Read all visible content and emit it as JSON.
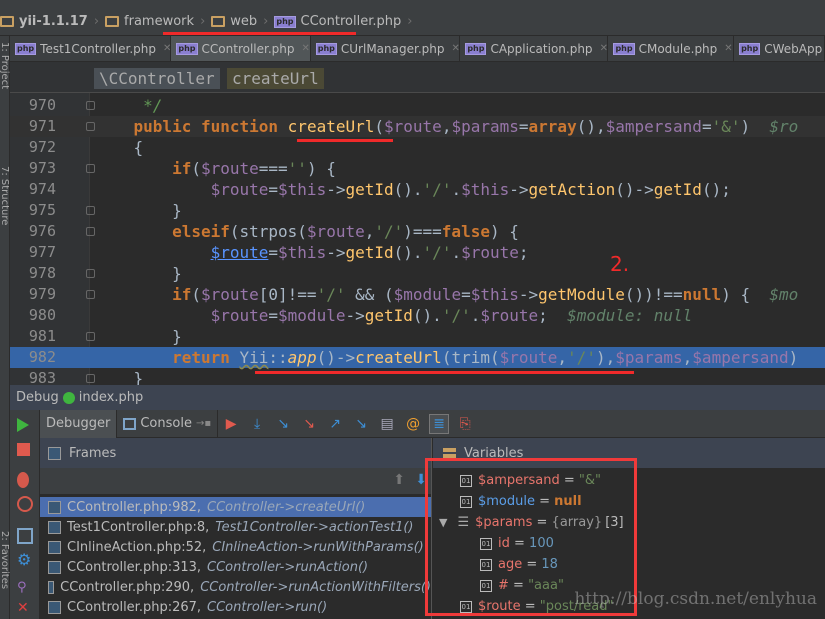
{
  "breadcrumb": [
    "yii-1.1.17",
    "framework",
    "web",
    "CController.php"
  ],
  "tabs": [
    {
      "label": "Test1Controller.php",
      "active": false
    },
    {
      "label": "CController.php",
      "active": true
    },
    {
      "label": "CUrlManager.php",
      "active": false
    },
    {
      "label": "CApplication.php",
      "active": false
    },
    {
      "label": "CModule.php",
      "active": false
    },
    {
      "label": "CWebApp",
      "active": false
    }
  ],
  "side_labels": {
    "project": "1: Project",
    "structure": "7: Structure",
    "favorites": "2: Favorites"
  },
  "navbar": {
    "class": "\\CController",
    "method": "createUrl"
  },
  "editor": {
    "lines": [
      {
        "n": "970",
        "tokens": [
          [
            "t-com",
            "     */"
          ]
        ]
      },
      {
        "n": "971",
        "state": "cur",
        "tokens": [
          [
            "",
            "    "
          ],
          [
            "t-kw",
            "public"
          ],
          [
            "",
            " "
          ],
          [
            "t-kw",
            "function"
          ],
          [
            "",
            " "
          ],
          [
            "t-fn",
            "createUrl"
          ],
          [
            "",
            "("
          ],
          [
            "t-var",
            "$route"
          ],
          [
            "",
            ","
          ],
          [
            "t-var",
            "$params"
          ],
          [
            "",
            "="
          ],
          [
            "t-kw",
            "array"
          ],
          [
            "",
            "(),"
          ],
          [
            "t-var",
            "$ampersand"
          ],
          [
            "",
            "="
          ],
          [
            "t-str",
            "'&'"
          ],
          [
            "",
            ")  "
          ],
          [
            "t-dbg",
            "$ro"
          ]
        ]
      },
      {
        "n": "972",
        "tokens": [
          [
            "",
            "    {"
          ]
        ]
      },
      {
        "n": "973",
        "tokens": [
          [
            "",
            "        "
          ],
          [
            "t-kw",
            "if"
          ],
          [
            "",
            "("
          ],
          [
            "t-var",
            "$route"
          ],
          [
            "",
            "==="
          ],
          [
            "t-str",
            "''"
          ],
          [
            "",
            ") {"
          ]
        ]
      },
      {
        "n": "974",
        "tokens": [
          [
            "",
            "            "
          ],
          [
            "t-var",
            "$route"
          ],
          [
            "",
            "="
          ],
          [
            "t-var",
            "$this"
          ],
          [
            "",
            "->"
          ],
          [
            "t-fn",
            "getId"
          ],
          [
            "",
            "()."
          ],
          [
            "t-str",
            "'/'"
          ],
          [
            "",
            "."
          ],
          [
            "t-var",
            "$this"
          ],
          [
            "",
            "->"
          ],
          [
            "t-fn",
            "getAction"
          ],
          [
            "",
            "()->"
          ],
          [
            "t-fn",
            "getId"
          ],
          [
            "",
            "();"
          ]
        ]
      },
      {
        "n": "975",
        "tokens": [
          [
            "",
            "        }"
          ]
        ]
      },
      {
        "n": "976",
        "tokens": [
          [
            "",
            "        "
          ],
          [
            "t-kw",
            "elseif"
          ],
          [
            "",
            "(strpos("
          ],
          [
            "t-var",
            "$route"
          ],
          [
            "",
            ","
          ],
          [
            "t-str",
            "'/'"
          ],
          [
            "",
            ")==="
          ],
          [
            "t-kw",
            "false"
          ],
          [
            "",
            ") {"
          ]
        ]
      },
      {
        "n": "977",
        "tokens": [
          [
            "",
            "            "
          ],
          [
            "t-link",
            "$route"
          ],
          [
            "",
            "="
          ],
          [
            "t-var",
            "$this"
          ],
          [
            "",
            "->"
          ],
          [
            "t-fn",
            "getId"
          ],
          [
            "",
            "()."
          ],
          [
            "t-str",
            "'/'"
          ],
          [
            "",
            "."
          ],
          [
            "t-var",
            "$route"
          ],
          [
            "",
            ";"
          ]
        ]
      },
      {
        "n": "978",
        "tokens": [
          [
            "",
            "        }"
          ]
        ]
      },
      {
        "n": "979",
        "tokens": [
          [
            "",
            "        "
          ],
          [
            "t-kw",
            "if"
          ],
          [
            "",
            "("
          ],
          [
            "t-var",
            "$route"
          ],
          [
            "",
            "[0]!=="
          ],
          [
            "t-str",
            "'/'"
          ],
          [
            "",
            " && ("
          ],
          [
            "t-var",
            "$module"
          ],
          [
            "",
            "="
          ],
          [
            "t-var",
            "$this"
          ],
          [
            "",
            "->"
          ],
          [
            "t-fn",
            "getModule"
          ],
          [
            "",
            "())!=="
          ],
          [
            "t-kw",
            "null"
          ],
          [
            "",
            ") {  "
          ],
          [
            "t-dbg",
            "$mo"
          ]
        ]
      },
      {
        "n": "980",
        "tokens": [
          [
            "",
            "            "
          ],
          [
            "t-var",
            "$route"
          ],
          [
            "",
            "="
          ],
          [
            "t-var",
            "$module"
          ],
          [
            "",
            "->"
          ],
          [
            "t-fn",
            "getId"
          ],
          [
            "",
            "()."
          ],
          [
            "t-str",
            "'/'"
          ],
          [
            "",
            "."
          ],
          [
            "t-var",
            "$route"
          ],
          [
            "",
            ";  "
          ],
          [
            "t-dbg",
            "$module: null"
          ]
        ]
      },
      {
        "n": "981",
        "tokens": [
          [
            "",
            "        }"
          ]
        ]
      },
      {
        "n": "982",
        "state": "sel",
        "tokens": [
          [
            "",
            "        "
          ],
          [
            "t-kw",
            "return"
          ],
          [
            "",
            " "
          ],
          [
            "t-cls",
            "Yii"
          ],
          [
            "",
            "::"
          ],
          [
            "t-it",
            "app"
          ],
          [
            "",
            "()->"
          ],
          [
            "t-fn",
            "createUrl"
          ],
          [
            "",
            "(trim("
          ],
          [
            "t-var",
            "$route"
          ],
          [
            "",
            ","
          ],
          [
            "t-str",
            "'/'"
          ],
          [
            "",
            "),"
          ],
          [
            "t-var",
            "$params"
          ],
          [
            "",
            ","
          ],
          [
            "t-var",
            "$ampersand"
          ],
          [
            "",
            ")"
          ]
        ]
      },
      {
        "n": "983",
        "tokens": [
          [
            "",
            "    }"
          ]
        ]
      }
    ]
  },
  "debug": {
    "title": "Debug",
    "config": "index.php",
    "tabs": {
      "debugger": "Debugger",
      "console": "Console"
    },
    "frames_title": "Frames",
    "variables_title": "Variables",
    "frames": [
      {
        "loc": "CController.php:982,",
        "method": "CController->createUrl()",
        "selected": true
      },
      {
        "loc": "Test1Controller.php:8,",
        "method": "Test1Controller->actionTest1()"
      },
      {
        "loc": "CInlineAction.php:52,",
        "method": "CInlineAction->runWithParams()"
      },
      {
        "loc": "CController.php:313,",
        "method": "CController->runAction()"
      },
      {
        "loc": "CController.php:290,",
        "method": "CController->runActionWithFilters()"
      },
      {
        "loc": "CController.php:267,",
        "method": "CController->run()"
      }
    ],
    "variables": {
      "ampersand": {
        "name": "$ampersand",
        "eq": " = ",
        "value": "\"&\""
      },
      "module": {
        "name": "$module",
        "eq": " = ",
        "value": "null"
      },
      "params": {
        "name": "$params",
        "eq": " = ",
        "type": "{array}",
        "count": "[3]",
        "children": [
          {
            "name": "id",
            "eq": " = ",
            "value": "100"
          },
          {
            "name": "age",
            "eq": " = ",
            "value": "18"
          },
          {
            "name": "#",
            "eq": " = ",
            "value": "\"aaa\""
          }
        ]
      },
      "route": {
        "name": "$route",
        "eq": " = ",
        "value": "\"post/read\""
      }
    }
  },
  "annotation": {
    "label": "2.",
    "color": "#f02a2a"
  },
  "watermark": "http://blog.csdn.net/enlyhua",
  "colors": {
    "keyword": "#cc7832",
    "variable": "#9876aa",
    "function": "#ffc66d",
    "string": "#6a8759",
    "selection": "#3565a7"
  }
}
